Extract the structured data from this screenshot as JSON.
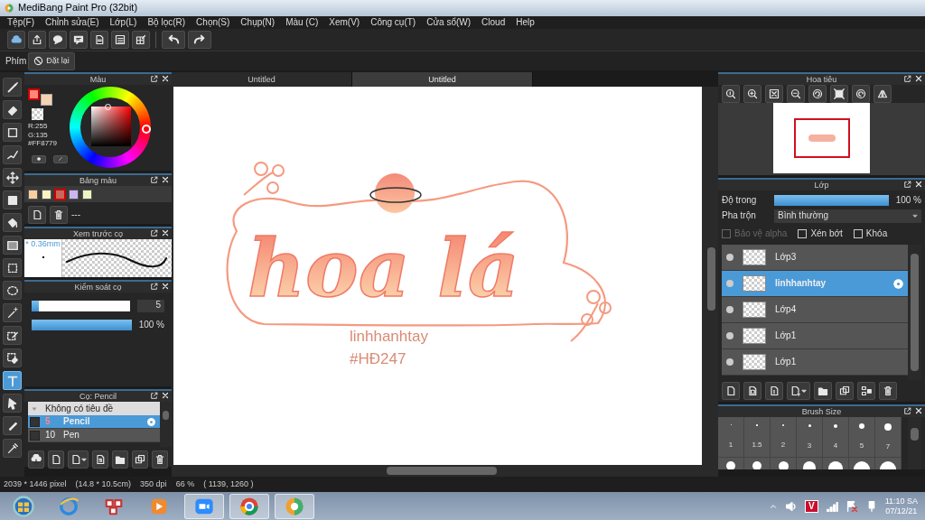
{
  "window": {
    "title": "MediBang Paint Pro (32bit)"
  },
  "menu": [
    "Tệp(F)",
    "Chỉnh sửa(E)",
    "Lớp(L)",
    "Bộ lọc(R)",
    "Chọn(S)",
    "Chụp(N)",
    "Màu (C)",
    "Xem(V)",
    "Công cụ(T)",
    "Cửa sổ(W)",
    "Cloud",
    "Help"
  ],
  "shortcut_bar": {
    "label": "Phím",
    "reset": "Đặt lại"
  },
  "tools": [
    {
      "selected": false
    },
    {
      "selected": false
    },
    {
      "selected": false
    },
    {
      "selected": false
    },
    {
      "selected": false
    },
    {
      "selected": false
    },
    {
      "selected": false
    },
    {
      "selected": false
    },
    {
      "selected": false
    },
    {
      "selected": false
    },
    {
      "selected": false
    },
    {
      "selected": false
    },
    {
      "selected": false
    },
    {
      "selected": true
    },
    {
      "selected": false
    },
    {
      "selected": false
    },
    {
      "selected": false
    }
  ],
  "color_panel": {
    "title": "Màu",
    "red": "R:255",
    "green": "G:135",
    "hex": "#FF8779"
  },
  "palette_panel": {
    "title": "Bảng màu",
    "swatches": [
      {
        "color": "#f9cfa0",
        "selected": false
      },
      {
        "color": "#f8f3c0",
        "selected": false
      },
      {
        "color": "#c8685a",
        "selected": true
      },
      {
        "color": "#c9b7f0",
        "selected": false
      },
      {
        "color": "#eef5c0",
        "selected": false
      }
    ],
    "palette_name": "---"
  },
  "brush_preview": {
    "title": "Xem trước cọ",
    "size": "* 0.36mm"
  },
  "brush_control": {
    "title": "Kiểm soát cọ",
    "size_slider": {
      "level": 0.07,
      "reading": "5"
    },
    "opacity_slider": {
      "level": 1,
      "reading": "100 %"
    }
  },
  "brush_list": {
    "title": "Cọ: Pencil",
    "group": "Không có tiêu đề",
    "brushes": [
      {
        "size": "5",
        "name": "Pencil",
        "selected": true
      },
      {
        "size": "10",
        "name": "Pen",
        "selected": false
      }
    ]
  },
  "canvas_tabs": [
    {
      "label": "Untitled",
      "selected": false
    },
    {
      "label": "Untitled",
      "selected": true
    }
  ],
  "canvas": {
    "lettering": "hoa lá",
    "captions": [
      "linhhanhtay",
      "#HĐ247"
    ]
  },
  "navigator": {
    "title": "Hoa tiêu"
  },
  "layers_panel": {
    "title": "Lớp",
    "opacity_label": "Độ trong",
    "opacity": {
      "level": 1,
      "reading": "100 %"
    },
    "blend_label": "Pha trộn",
    "blend_mode": "Bình thường",
    "options": [
      {
        "label": "Bảo vệ alpha",
        "checked": false,
        "disabled": true
      },
      {
        "label": "Xén bớt",
        "checked": false,
        "disabled": false
      },
      {
        "label": "Khóa",
        "checked": false,
        "disabled": false
      }
    ],
    "layers": [
      {
        "name": "Lớp3",
        "selected": false
      },
      {
        "name": "linhhanhtay",
        "selected": true
      },
      {
        "name": "Lớp4",
        "selected": false
      },
      {
        "name": "Lớp1",
        "selected": false
      },
      {
        "name": "Lớp1",
        "selected": false
      }
    ]
  },
  "brush_size_panel": {
    "title": "Brush Size",
    "sizes": [
      "1",
      "1.5",
      "2",
      "3",
      "4",
      "5",
      "7"
    ]
  },
  "status_bar": {
    "dimensions": "2039 * 1446 pixel",
    "physical_size": "(14.8 * 10.5cm)",
    "resolution": "350 dpi",
    "zoom": "66 %",
    "cursor": "( 1139, 1260 )"
  },
  "taskbar": {
    "antivirus_label": "V",
    "time": "11:10 SA",
    "date": "07/12/21"
  }
}
